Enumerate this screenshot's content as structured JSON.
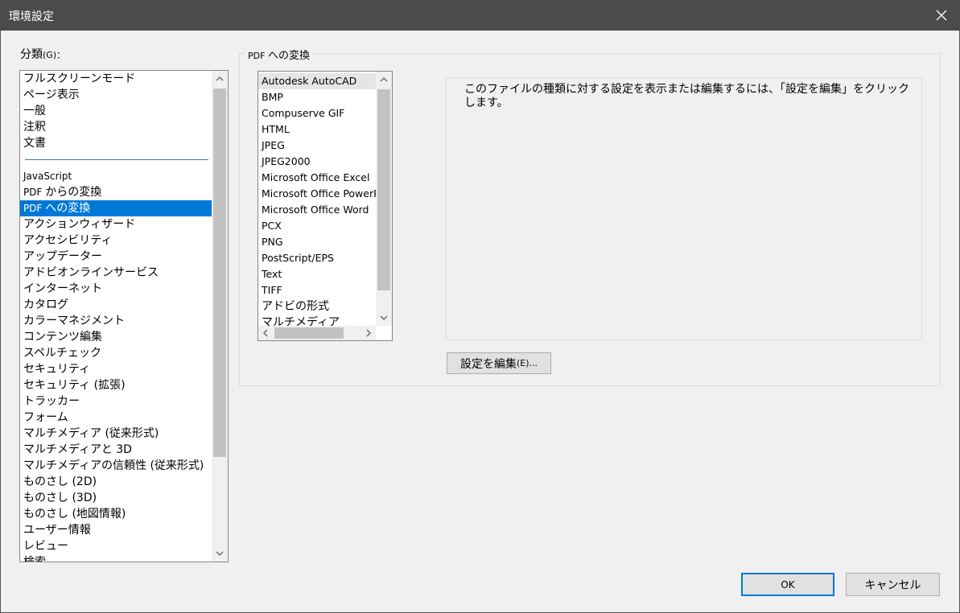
{
  "window": {
    "title": "環境設定",
    "close_icon": "close-icon"
  },
  "category": {
    "label": "分類",
    "accel": "(G)：",
    "items_top": [
      "フルスクリーンモード",
      "ページ表示",
      "一般",
      "注釈",
      "文書"
    ],
    "items": [
      {
        "prefix": "JavaScript",
        "text": "",
        "small": true
      },
      {
        "prefix": "PDF ",
        "text": "からの変換"
      },
      {
        "prefix": "PDF ",
        "text": "への変換",
        "selected": true
      },
      {
        "text": "アクションウィザード"
      },
      {
        "text": "アクセシビリティ"
      },
      {
        "text": "アップデーター"
      },
      {
        "text": "アドビオンラインサービス"
      },
      {
        "text": "インターネット"
      },
      {
        "text": "カタログ"
      },
      {
        "text": "カラーマネジメント"
      },
      {
        "text": "コンテンツ編集"
      },
      {
        "text": "スペルチェック"
      },
      {
        "text": "セキュリティ"
      },
      {
        "text": "セキュリティ (拡張)"
      },
      {
        "text": "トラッカー"
      },
      {
        "text": "フォーム"
      },
      {
        "text": "マルチメディア (従来形式)"
      },
      {
        "text": "マルチメディアと 3D"
      },
      {
        "text": "マルチメディアの信頼性 (従来形式)"
      },
      {
        "text": "ものさし (2D)"
      },
      {
        "text": "ものさし (3D)"
      },
      {
        "text": "ものさし (地図情報)"
      },
      {
        "text": "ユーザー情報"
      },
      {
        "text": "レビュー"
      },
      {
        "text": "検索"
      }
    ]
  },
  "group": {
    "title_prefix": "PDF ",
    "title": "への変換"
  },
  "formats": {
    "items": [
      {
        "text": "Autodesk AutoCAD",
        "selected": true
      },
      {
        "text": "BMP"
      },
      {
        "text": "Compuserve GIF"
      },
      {
        "text": "HTML"
      },
      {
        "text": "JPEG"
      },
      {
        "text": "JPEG2000"
      },
      {
        "text": "Microsoft Office Excel"
      },
      {
        "text": "Microsoft Office PowerPoint"
      },
      {
        "text": "Microsoft Office Word"
      },
      {
        "text": "PCX"
      },
      {
        "text": "PNG"
      },
      {
        "text": "PostScript/EPS"
      },
      {
        "text": "Text"
      },
      {
        "text": "TIFF"
      },
      {
        "text": "アドビの形式",
        "jp": true
      },
      {
        "text": "マルチメディア",
        "jp": true
      }
    ]
  },
  "description": {
    "text": "このファイルの種類に対する設定を表示または編集するには、「設定を編集」をクリックします。"
  },
  "buttons": {
    "edit_label": "設定を編集",
    "edit_accel": "(E)...",
    "ok_label": "OK",
    "cancel_label": "キャンセル"
  },
  "icons": {
    "scroll_up": "chevron-up-icon",
    "scroll_down": "chevron-down-icon",
    "scroll_left": "chevron-left-icon",
    "scroll_right": "chevron-right-icon"
  },
  "colors": {
    "titlebar": "#4b4b4b",
    "selection": "#0078d7",
    "separator": "#2b7fc0"
  }
}
